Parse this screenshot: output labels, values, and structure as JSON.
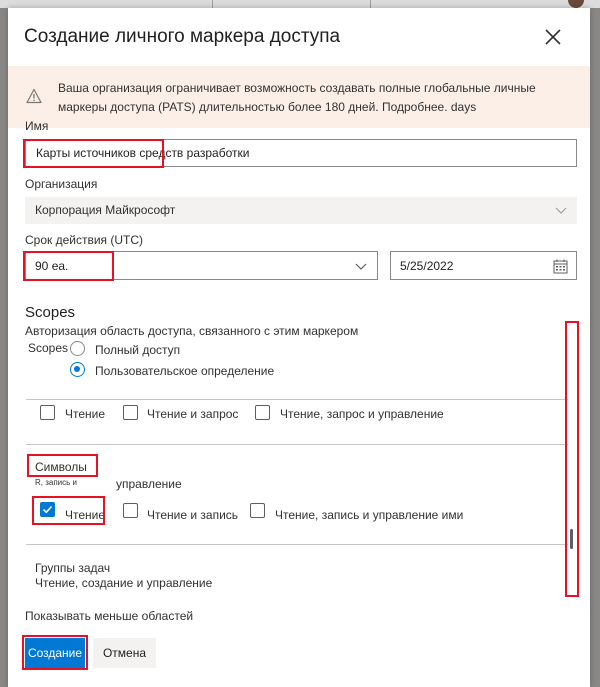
{
  "dialog": {
    "title": "Создание личного маркера доступа",
    "warning": "Ваша организация ограничивает возможность создавать полные глобальные личные маркеры доступа (PATS) длительностью более 180 дней. Подробнее. days"
  },
  "form": {
    "name_label": "Имя",
    "name_value": "Карты источников средств разработки",
    "org_label": "Организация",
    "org_value": "Корпорация Майкрософт",
    "expiry_label": "Срок действия (UTC)",
    "expiry_value": "90",
    "expiry_unit": "еа.",
    "date_value": "5/25/2022"
  },
  "scopes": {
    "title": "Scopes",
    "description": "Авторизация область доступа, связанного с этим маркером",
    "scopes_label": "Scopes",
    "full_access": "Полный доступ",
    "custom": "Пользовательское определение",
    "row1": [
      "Чтение",
      "Чтение и запрос",
      "Чтение, запрос и управление"
    ],
    "symbols_title": "Символы",
    "symbols_sub_small": "R, запись и",
    "symbols_sub": "управление",
    "row2": [
      "Чтение",
      "Чтение и запись",
      "Чтение, запись и управление ими"
    ],
    "tasks_title": "Группы задач",
    "tasks_desc": "Чтение, создание и управление",
    "show_less": "Показывать меньше областей"
  },
  "buttons": {
    "create": "Создание",
    "cancel": "Отмена"
  },
  "colors": {
    "accent": "#0078d4",
    "highlight": "#e81123",
    "warning_bg": "#fcefe8"
  }
}
